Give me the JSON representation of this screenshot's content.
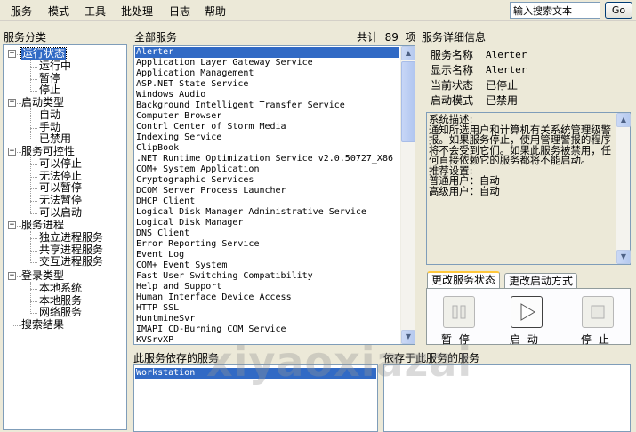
{
  "menu": [
    "服务",
    "模式",
    "工具",
    "批处理",
    "日志",
    "帮助"
  ],
  "search": {
    "value": "输入搜索文本",
    "go_label": "Go"
  },
  "tree": {
    "title": "服务分类",
    "nodes": [
      {
        "label": "运行状态",
        "children": [
          "运行中",
          "暂停",
          "停止"
        ]
      },
      {
        "label": "启动类型",
        "children": [
          "自动",
          "手动",
          "已禁用"
        ]
      },
      {
        "label": "服务可控性",
        "children": [
          "可以停止",
          "无法停止",
          "可以暂停",
          "无法暂停",
          "可以启动"
        ]
      },
      {
        "label": "服务进程",
        "children": [
          "独立进程服务",
          "共享进程服务",
          "交互进程服务"
        ]
      },
      {
        "label": "登录类型",
        "children": [
          "本地系统",
          "本地服务",
          "网络服务"
        ]
      }
    ],
    "search_results": "搜索结果",
    "selected": "运行状态"
  },
  "all_services": {
    "title": "全部服务",
    "count_label": "共计  89  项",
    "items": [
      "Alerter",
      "Application Layer Gateway Service",
      "Application Management",
      "ASP.NET State Service",
      "Windows Audio",
      "Background Intelligent Transfer Service",
      "Computer Browser",
      "Contrl Center of Storm Media",
      "Indexing Service",
      "ClipBook",
      ".NET Runtime Optimization Service v2.0.50727_X86",
      "COM+ System Application",
      "Cryptographic Services",
      "DCOM Server Process Launcher",
      "DHCP Client",
      "Logical Disk Manager Administrative Service",
      "Logical Disk Manager",
      "DNS Client",
      "Error Reporting Service",
      "Event Log",
      "COM+ Event System",
      "Fast User Switching Compatibility",
      "Help and Support",
      "Human Interface Device Access",
      "HTTP SSL",
      "HuntmineSvr",
      "IMAPI CD-Burning COM Service",
      "KVSrvXP"
    ],
    "selected": "Alerter"
  },
  "details": {
    "title": "服务详细信息",
    "fields": [
      {
        "key": "服务名称",
        "value": "Alerter"
      },
      {
        "key": "显示名称",
        "value": "Alerter"
      },
      {
        "key": "当前状态",
        "value": "已停止"
      },
      {
        "key": "启动模式",
        "value": "已禁用"
      }
    ],
    "description": "系统描述:\n通知所选用户和计算机有关系统管理级警报。如果服务停止，使用管理警报的程序将不会受到它们。如果此服务被禁用，任何直接依赖它的服务都将不能启动。\n推荐设置:\n普通用户：自动\n高级用户：自动"
  },
  "tabs": {
    "status": "更改服务状态",
    "startup": "更改启动方式"
  },
  "controls": {
    "pause": "暂 停",
    "start": "启 动",
    "stop": "停 止"
  },
  "depends_on": {
    "title": "此服务依存的服务",
    "items": [
      "Workstation"
    ]
  },
  "dependents": {
    "title": "依存于此服务的服务",
    "items": []
  },
  "watermark": "xiyaoxiazai",
  "colors": {
    "selection": "#316ac5",
    "window_bg": "#ece9d8",
    "border": "#7f9db9"
  }
}
